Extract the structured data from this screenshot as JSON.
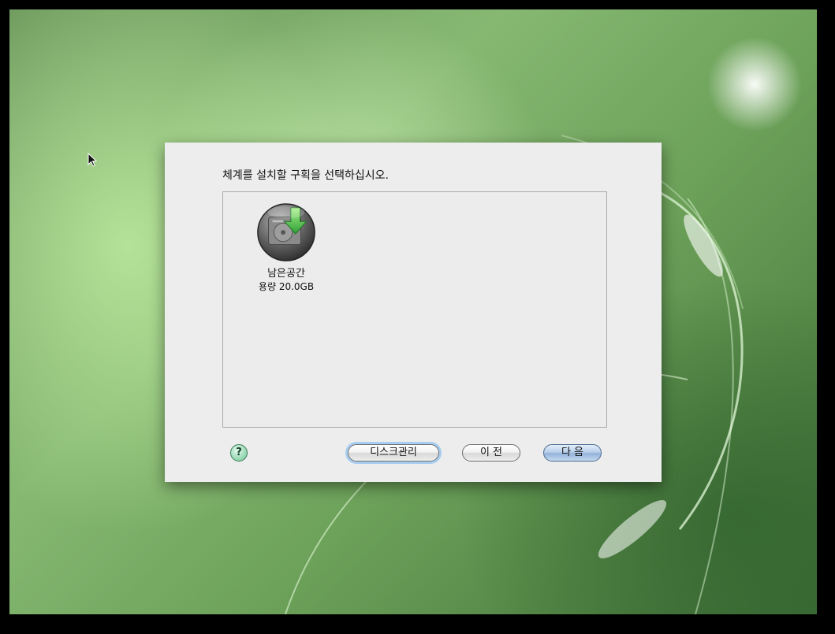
{
  "dialog": {
    "prompt": "체계를 설치할 구획을 선택하십시오.",
    "partitions": [
      {
        "name": "남은공간",
        "size_label": "용량",
        "size_value": "20.0GB",
        "icon": "disk-install-icon"
      }
    ],
    "buttons": {
      "help": "?",
      "disk_management": "디스크관리",
      "previous": "이 전",
      "next": "다 음"
    }
  },
  "colors": {
    "dialog_background": "#ededed",
    "default_button": "#94b3d9",
    "focus_ring": "#a7cdf0",
    "help_button": "#8fd4ad",
    "install_arrow": "#45c64a"
  }
}
